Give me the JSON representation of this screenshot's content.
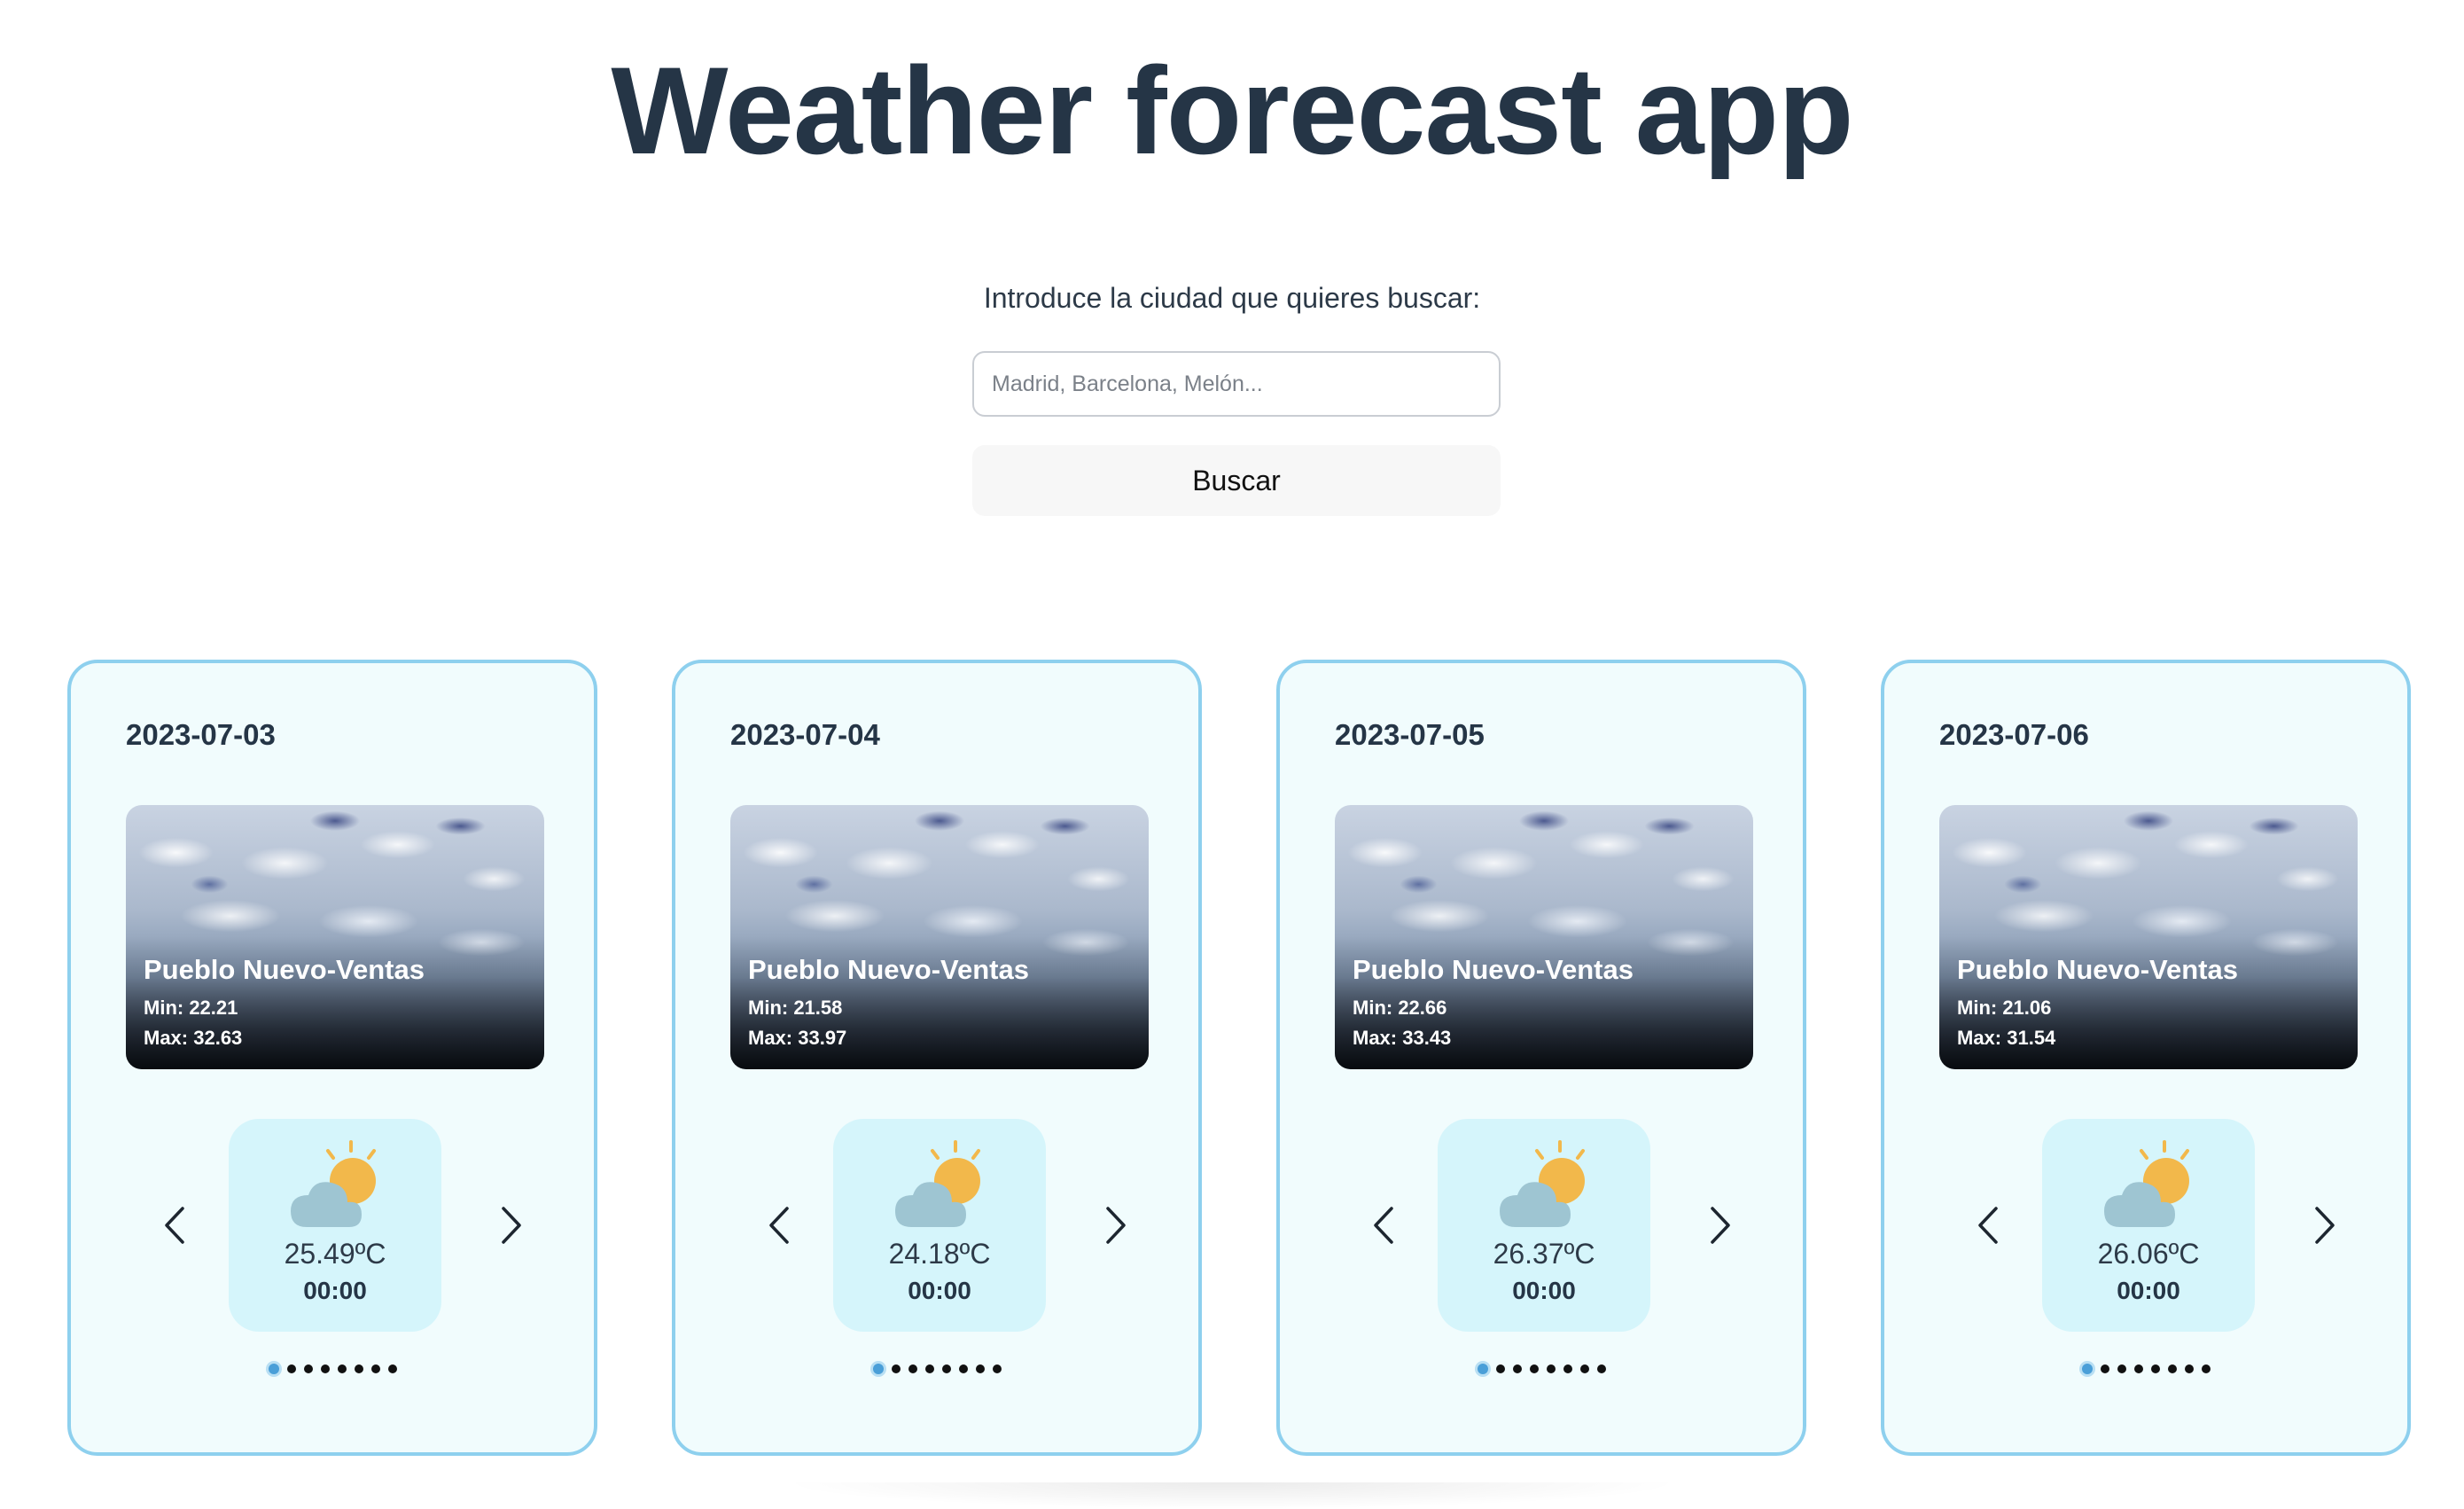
{
  "app": {
    "title": "Weather forecast app"
  },
  "search": {
    "label": "Introduce la ciudad que quieres buscar:",
    "placeholder": "Madrid, Barcelona, Melón...",
    "value": "",
    "button_label": "Buscar"
  },
  "cards": [
    {
      "date": "2023-07-03",
      "city": "Pueblo Nuevo-Ventas",
      "min": "Min: 22.21",
      "max": "Max: 32.63",
      "slide": {
        "temp": "25.49ºC",
        "hour": "00:00",
        "icon": "partly-cloudy-icon"
      },
      "dots_total": 8,
      "dots_active": 0
    },
    {
      "date": "2023-07-04",
      "city": "Pueblo Nuevo-Ventas",
      "min": "Min: 21.58",
      "max": "Max: 33.97",
      "slide": {
        "temp": "24.18ºC",
        "hour": "00:00",
        "icon": "partly-cloudy-icon"
      },
      "dots_total": 8,
      "dots_active": 0
    },
    {
      "date": "2023-07-05",
      "city": "Pueblo Nuevo-Ventas",
      "min": "Min: 22.66",
      "max": "Max: 33.43",
      "slide": {
        "temp": "26.37ºC",
        "hour": "00:00",
        "icon": "partly-cloudy-icon"
      },
      "dots_total": 8,
      "dots_active": 0
    },
    {
      "date": "2023-07-06",
      "city": "Pueblo Nuevo-Ventas",
      "min": "Min: 21.06",
      "max": "Max: 31.54",
      "slide": {
        "temp": "26.06ºC",
        "hour": "00:00",
        "icon": "partly-cloudy-icon"
      },
      "dots_total": 8,
      "dots_active": 0
    }
  ],
  "colors": {
    "title": "#253546",
    "card_border": "#8ed0ee",
    "card_bg": "#f1fcfd",
    "slide_bg": "#d5f5fb",
    "sun": "#f2b84b",
    "cloud": "#9ec5d2",
    "dot_active": "#4a9fd8"
  }
}
